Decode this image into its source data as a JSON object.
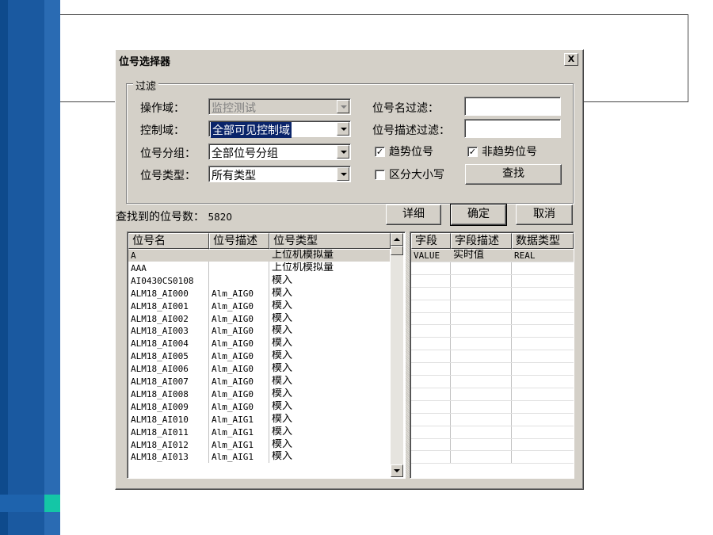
{
  "dialog": {
    "title": "位号选择器",
    "close_glyph": "X"
  },
  "filter": {
    "group_label": "过滤",
    "domain_label": "操作域：",
    "domain_value": "监控测试",
    "control_label": "控制域：",
    "control_value": "全部可见控制域",
    "group_select_label": "位号分组：",
    "group_select_value": "全部位号分组",
    "type_label": "位号类型：",
    "type_value": "所有类型",
    "name_filter_label": "位号名过滤：",
    "name_filter_value": "",
    "desc_filter_label": "位号描述过滤：",
    "desc_filter_value": "",
    "trend_label": "趋势位号",
    "trend_checked": true,
    "nontrend_label": "非趋势位号",
    "nontrend_checked": true,
    "case_label": "区分大小写",
    "case_checked": false,
    "search_label": "查找"
  },
  "summary": {
    "found_label": "查找到的位号数：",
    "found_count": "5820"
  },
  "actions": {
    "detail_label": "详细",
    "ok_label": "确定",
    "cancel_label": "取消"
  },
  "tag_list": {
    "columns": [
      "位号名",
      "位号描述",
      "位号类型"
    ],
    "rows": [
      [
        "A",
        "",
        "上位机模拟量"
      ],
      [
        "AAA",
        "",
        "上位机模拟量"
      ],
      [
        "AI0430CS0108",
        "",
        "模入"
      ],
      [
        "ALM18_AI000",
        "Alm_AIG0",
        "模入"
      ],
      [
        "ALM18_AI001",
        "Alm_AIG0",
        "模入"
      ],
      [
        "ALM18_AI002",
        "Alm_AIG0",
        "模入"
      ],
      [
        "ALM18_AI003",
        "Alm_AIG0",
        "模入"
      ],
      [
        "ALM18_AI004",
        "Alm_AIG0",
        "模入"
      ],
      [
        "ALM18_AI005",
        "Alm_AIG0",
        "模入"
      ],
      [
        "ALM18_AI006",
        "Alm_AIG0",
        "模入"
      ],
      [
        "ALM18_AI007",
        "Alm_AIG0",
        "模入"
      ],
      [
        "ALM18_AI008",
        "Alm_AIG0",
        "模入"
      ],
      [
        "ALM18_AI009",
        "Alm_AIG0",
        "模入"
      ],
      [
        "ALM18_AI010",
        "Alm_AIG1",
        "模入"
      ],
      [
        "ALM18_AI011",
        "Alm_AIG1",
        "模入"
      ],
      [
        "ALM18_AI012",
        "Alm_AIG1",
        "模入"
      ],
      [
        "ALM18_AI013",
        "Alm_AIG1",
        "模入"
      ]
    ]
  },
  "field_list": {
    "columns": [
      "字段",
      "字段描述",
      "数据类型"
    ],
    "rows": [
      [
        "VALUE",
        "实时值",
        "REAL"
      ]
    ]
  }
}
